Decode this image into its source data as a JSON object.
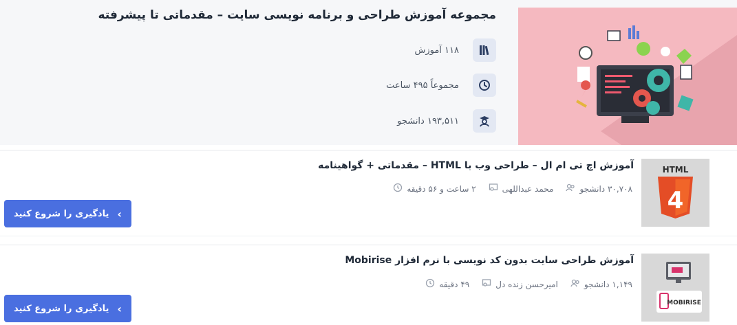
{
  "series": {
    "title": "مجموعه آموزش طراحی و برنامه نویسی سایت – مقدماتی تا پیشرفته",
    "stats": [
      {
        "icon": "books-icon",
        "text": "۱۱۸ آموزش"
      },
      {
        "icon": "clock-icon",
        "text": "مجموعاً ۴۹۵ ساعت"
      },
      {
        "icon": "student-icon",
        "text": "۱۹۳,۵۱۱ دانشجو"
      }
    ]
  },
  "courses": [
    {
      "title": "آموزش اچ تی ام ال – طراحی وب با HTML – مقدماتی + گواهینامه",
      "thumb_label": "HTML",
      "thumb_number": "4",
      "students": "۳۰,۷۰۸ دانشجو",
      "teacher": "محمد عبداللهی",
      "duration": "۲ ساعت و ۵۶ دقیقه",
      "button": "یادگیری را شروع کنید"
    },
    {
      "title": "آموزش طراحی سایت بدون کد نویسی با نرم افزار Mobirise",
      "thumb_label": "MOBIRISE",
      "students": "۱,۱۴۹ دانشجو",
      "teacher": "امیرحسن زنده دل",
      "duration": "۴۹ دقیقه",
      "button": "یادگیری را شروع کنید"
    }
  ],
  "colors": {
    "accent": "#4a6fe0",
    "hero_bg": "#f5b9c0",
    "html5_orange": "#e44d26"
  }
}
